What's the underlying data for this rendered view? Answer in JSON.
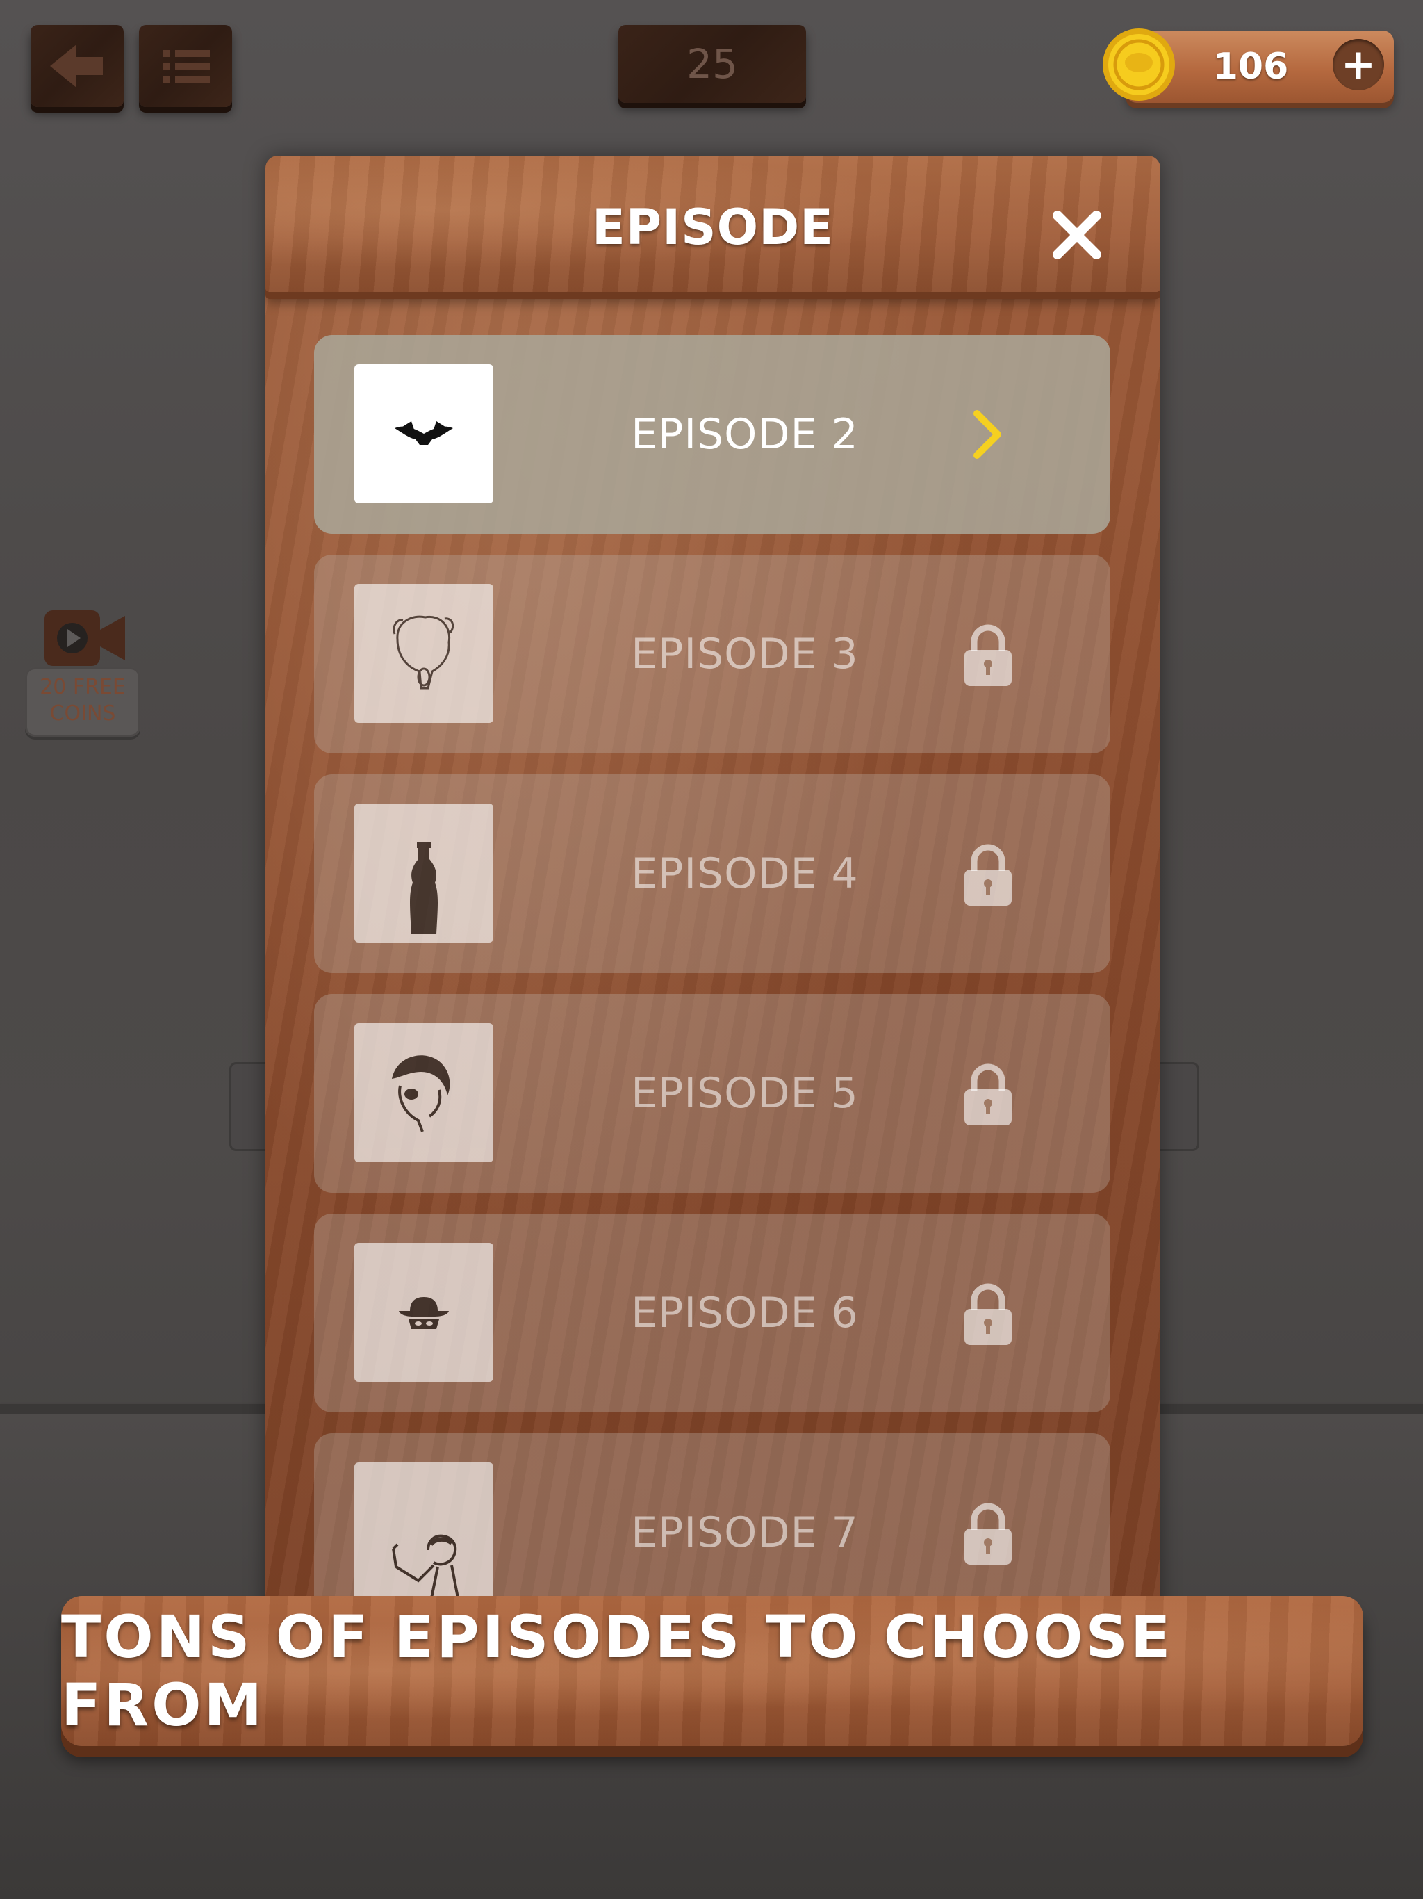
{
  "topbar": {
    "back_icon": "back-arrow-icon",
    "menu_icon": "list-icon",
    "level_number": "25",
    "coins": "106",
    "coin_icon": "gold-coin-icon",
    "add_coins_label": "+"
  },
  "free_coins": {
    "icon": "video-camera-icon",
    "label": "20 FREE\nCOINS"
  },
  "modal": {
    "title": "EPISODE",
    "close_icon": "close-icon",
    "episodes": [
      {
        "label": "EPISODE 2",
        "thumbnail": "wings-logo",
        "status": "unlocked",
        "action_icon": "chevron-right-icon"
      },
      {
        "label": "EPISODE 3",
        "thumbnail": "einstein-portrait",
        "status": "locked",
        "action_icon": "lock-icon"
      },
      {
        "label": "EPISODE 4",
        "thumbnail": "cola-bottle",
        "status": "locked",
        "action_icon": "lock-icon"
      },
      {
        "label": "EPISODE 5",
        "thumbnail": "pirate-portrait",
        "status": "locked",
        "action_icon": "lock-icon"
      },
      {
        "label": "EPISODE 6",
        "thumbnail": "masked-hat",
        "status": "locked",
        "action_icon": "lock-icon"
      },
      {
        "label": "EPISODE 7",
        "thumbnail": "singer-pointing",
        "status": "locked",
        "action_icon": "lock-icon"
      }
    ]
  },
  "banner": {
    "text": "TONS OF EPISODES TO CHOOSE FROM"
  },
  "colors": {
    "background": "#4a4746",
    "wood": "#9c5a38",
    "accent_yellow": "#f5d020",
    "coin_gold": "#f3c316"
  }
}
